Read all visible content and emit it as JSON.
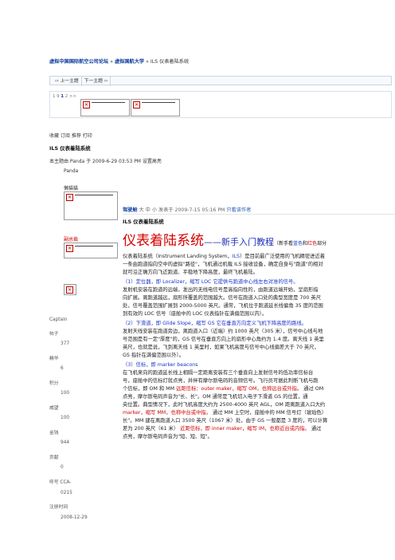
{
  "breadcrumb": {
    "forum": "虚拟中国国际航空公司论坛",
    "sep": "»",
    "board": "虚拟国航大学",
    "topic": "ILS 仪表着陆系统"
  },
  "topnav": {
    "prev": "‹‹ 上一主题",
    "next": "下一主题 ››"
  },
  "pager": {
    "text_prefix": "1 9 ",
    "current": "1",
    "text_mid": " 2",
    "text_suffix": " >>"
  },
  "actions": "收藏  订阅  推荐  打印",
  "thread": {
    "title": "ILS 仪表着陆系统",
    "meta": "本主题由 Panda 于 2009-6-29 03:53 PM  设置高亮",
    "username": "Panda"
  },
  "sidebar": {
    "nickname": "懒猫猫",
    "group": "副总裁",
    "rank": "Captain",
    "posts_label": "帖子",
    "posts_value": "377",
    "elite_label": "精华",
    "elite_value": "6",
    "points_label": "积分",
    "points_value": "100",
    "prestige_label": "威望",
    "prestige_value": "100",
    "money_label": "金钱",
    "money_value": "944",
    "contrib_label": "贡献",
    "contrib_value": "0",
    "callsign_label": "呼号 CCA-",
    "callsign_value": "0215",
    "reg_label": "注册时间",
    "reg_value": "2008-12-29"
  },
  "post": {
    "author": "驾驶舱",
    "online": "大 中 小",
    "posted": "发表于 2009-7-15 05:16 PM",
    "only_author": "只看该作者",
    "subject": "ILS 仪表着陆系统",
    "banner_main": "仪表着陆系统",
    "banner_dash": "——",
    "banner_sub": "新手入门教程",
    "banner_note_pre": "（新手看",
    "banner_blue": "蓝色",
    "banner_and": "和",
    "banner_red": "红色",
    "banner_note_post": "部分"
  },
  "content": {
    "p1a": "仪表着陆系统（Instrument Landing System，",
    "p1b": "ILS",
    "p1c": "）是目前最广泛使用的飞机精密进近着",
    "p1d": "一条由跑道指向空中的虚拟\"路径\"，飞机通过机载 ILS 接收设备，确定自身与\"跑道\"的相对",
    "p1e": "就可沿正确方向飞近跑道、平稳地下降高度，最终飞机着陆。",
    "h1": "（1）定位器，即 Localizer，缩写 LOC 它提供与跑道中心线左右对准的信号。",
    "p2a": "发射机安装在跑道的远端，发出的无线电信号是高指向性的，由跑道远端开始，呈扇形指",
    "p2b": "向扩展。离跑道越远，扇形所覆盖的范围越大。信号在跑道入口处的典型宽度是 700 英尺",
    "p2c": "处，信号覆盖范围扩展到 2000-5000 英尺。通常，飞机位于跑道延长线偏角 35 度的范围",
    "p2d": "到有效的 LOC 信号（座舱中的 LOC 仪表指针在满偏范围以内）。",
    "h2": "（2）下滑道，即 Glide Slope，缩写 GS 它在垂直方向定义飞机下降高度的路线。",
    "p3a": "发射天线安装在跑道旁边，离跑道入口（近端）约 1000 英尺（305 米），信号中心线与地",
    "p3b": "号范围是有一定\"厚度\"的，GS 信号在垂直方向上的扇形中心角约为 1.4 度。离天线 1 英里",
    "p3c": "英尺，也就是说，飞到离天线 1 英里时，如果飞机高度与信号中心线偏差大于 70 英尺，",
    "p3d": "GS 指针在满偏范围以外）。",
    "h3": "（3）信标，即 marker beacons",
    "p4a": "在飞机来向的跑道延长线上相隔一定距离安装有三个垂直向上发射信号的低功率信标台",
    "p4b": "号，座舱中的信标灯就点亮，并伴有摩尔斯电码的音频信号。飞行员可据此判断飞机与跑",
    "p4c1": "个信标，即 OM 和 MM",
    "p4c2": "远距信标：outer maker，缩写 OM，也称远台或外指。",
    "p4c3": "通过 OM",
    "p4d": "点亮，摩尔斯电码声音为\"长、长\"。OM 通常是飞机切入电子下滑道 GS 的位置，通",
    "p4e": "央位置。典型情况下，此时飞机高度大约为 2500-4000 英尺 AGL，OM 距离跑道入口大约",
    "p4f1": "marker，缩写 MM，也称中台或中指。",
    "p4f2": "通过 MM 上空时，座舱中的 MM 信号灯（琥珀色）",
    "p4g": "长\"。MM 建在离跑道入口 3500 英尺（1067 米）处，由于 GS 一般都是 3 度的，可以计算",
    "p4h1": "差为 200 英尺（61 米）",
    "p4h2": "近距信标，即 inner maker，缩写 IM，也称近台或内指。",
    "p4h3": "通过",
    "p4i": "点亮，摩尔斯电码声音为\"短、短、短\"。"
  }
}
